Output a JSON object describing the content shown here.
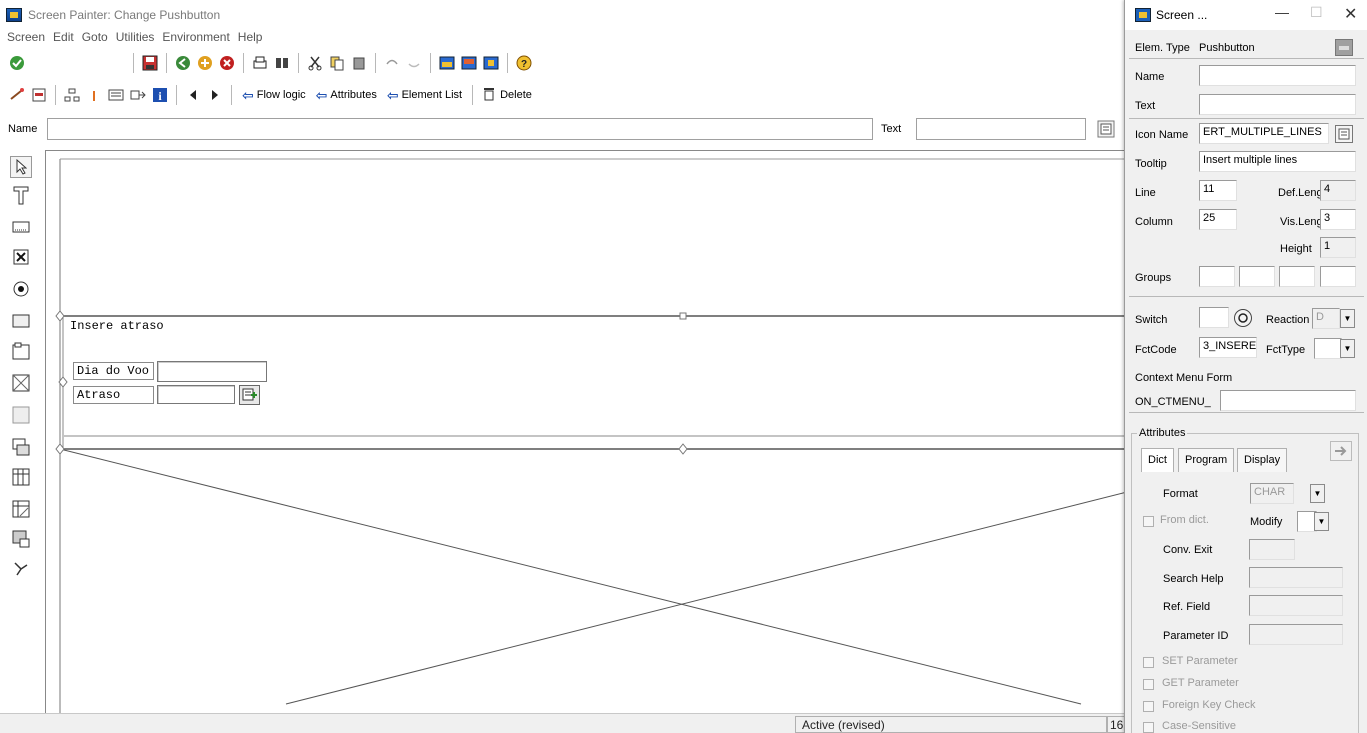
{
  "window": {
    "title": "Screen Painter: Change Pushbutton"
  },
  "menu": [
    "Screen",
    "Edit",
    "Goto",
    "Utilities",
    "Environment",
    "Help"
  ],
  "toolbar2": {
    "flow_logic": "Flow logic",
    "attributes": "Attributes",
    "element_list": "Element List",
    "delete": "Delete"
  },
  "namebar": {
    "name_label": "Name",
    "name_value": "",
    "text_label": "Text",
    "text_value": ""
  },
  "canvas": {
    "frame_title": "Insere atraso",
    "field1_label": "Dia do Voo",
    "field2_label": "Atraso"
  },
  "status": {
    "mode": "Active (revised)",
    "line": "16"
  },
  "attr": {
    "title": "Screen ...",
    "elem_type_label": "Elem. Type",
    "elem_type_value": "Pushbutton",
    "name_label": "Name",
    "name_value": "",
    "text_label": "Text",
    "text_value": "",
    "icon_name_label": "Icon Name",
    "icon_name_value": "ERT_MULTIPLE_LINES",
    "tooltip_label": "Tooltip",
    "tooltip_value": "Insert multiple lines",
    "line_label": "Line",
    "line_value": "11",
    "deflength_label": "Def.Lengt",
    "deflength_value": "4",
    "column_label": "Column",
    "column_value": "25",
    "vislength_label": "Vis.Length",
    "vislength_value": "3",
    "height_label": "Height",
    "height_value": "1",
    "groups_label": "Groups",
    "switch_label": "Switch",
    "reaction_label": "Reaction",
    "reaction_value": "D",
    "fctcode_label": "FctCode",
    "fctcode_value": "3_INSERE",
    "fcttype_label": "FctType",
    "context_menu_label": "Context Menu Form",
    "context_menu_value": "ON_CTMENU_",
    "attributes_group": "Attributes",
    "tabs": [
      "Dict",
      "Program",
      "Display"
    ],
    "format_label": "Format",
    "format_value": "CHAR",
    "from_dict_label": "From dict.",
    "modify_label": "Modify",
    "conv_exit_label": "Conv. Exit",
    "search_help_label": "Search Help",
    "ref_field_label": "Ref. Field",
    "parameter_id_label": "Parameter ID",
    "set_parameter_label": "SET Parameter",
    "get_parameter_label": "GET Parameter",
    "foreign_key_label": "Foreign Key Check",
    "case_sensitive_label": "Case-Sensitive"
  }
}
